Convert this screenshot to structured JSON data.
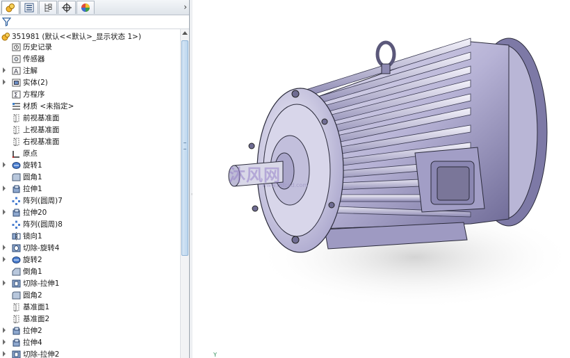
{
  "feature_manager": {
    "tabs": [
      {
        "icon": "feature-manager-icon"
      },
      {
        "icon": "property-manager-icon"
      },
      {
        "icon": "configuration-manager-icon"
      },
      {
        "icon": "dimxpert-icon"
      },
      {
        "icon": "display-manager-icon"
      }
    ],
    "more_glyph": "›",
    "root_label": "351981  (默认<<默认>_显示状态 1>)",
    "items": [
      {
        "label": "历史记录",
        "icon": "history-icon",
        "expandable": false
      },
      {
        "label": "传感器",
        "icon": "sensor-icon",
        "expandable": false
      },
      {
        "label": "注解",
        "icon": "annotation-icon",
        "expandable": true
      },
      {
        "label": "实体(2)",
        "icon": "solid-bodies-icon",
        "expandable": true
      },
      {
        "label": "方程序",
        "icon": "equation-icon",
        "expandable": false
      },
      {
        "label": "材质 <未指定>",
        "icon": "material-icon",
        "expandable": false
      },
      {
        "label": "前视基准面",
        "icon": "plane-icon",
        "expandable": false
      },
      {
        "label": "上视基准面",
        "icon": "plane-icon",
        "expandable": false
      },
      {
        "label": "右视基准面",
        "icon": "plane-icon",
        "expandable": false
      },
      {
        "label": "原点",
        "icon": "origin-icon",
        "expandable": false
      },
      {
        "label": "旋转1",
        "icon": "revolve-icon",
        "expandable": true
      },
      {
        "label": "圆角1",
        "icon": "fillet-icon",
        "expandable": false
      },
      {
        "label": "拉伸1",
        "icon": "extrude-icon",
        "expandable": true
      },
      {
        "label": "阵列(圆周)7",
        "icon": "circular-pattern-icon",
        "expandable": false
      },
      {
        "label": "拉伸20",
        "icon": "extrude-icon",
        "expandable": true
      },
      {
        "label": "阵列(圆周)8",
        "icon": "circular-pattern-icon",
        "expandable": false
      },
      {
        "label": "镜向1",
        "icon": "mirror-icon",
        "expandable": false
      },
      {
        "label": "切除-旋转4",
        "icon": "cut-revolve-icon",
        "expandable": true
      },
      {
        "label": "旋转2",
        "icon": "revolve-icon",
        "expandable": true
      },
      {
        "label": "倒角1",
        "icon": "chamfer-icon",
        "expandable": false
      },
      {
        "label": "切除-拉伸1",
        "icon": "cut-extrude-icon",
        "expandable": true
      },
      {
        "label": "圆角2",
        "icon": "fillet-icon",
        "expandable": false
      },
      {
        "label": "基准面1",
        "icon": "plane-icon",
        "expandable": false
      },
      {
        "label": "基准面2",
        "icon": "plane-icon",
        "expandable": false
      },
      {
        "label": "拉伸2",
        "icon": "extrude-icon",
        "expandable": true
      },
      {
        "label": "拉伸4",
        "icon": "extrude-icon",
        "expandable": true
      },
      {
        "label": "切除-拉伸2",
        "icon": "cut-extrude-icon",
        "expandable": true
      }
    ]
  },
  "viewport": {
    "watermark_text": "沐风网",
    "watermark_url": "www.mfcad.com",
    "triad_label": "Y"
  },
  "colors": {
    "tree_selection": "#cfe3f7",
    "model_body": "#b7b3d6",
    "model_shadow": "#d4d4d4"
  }
}
